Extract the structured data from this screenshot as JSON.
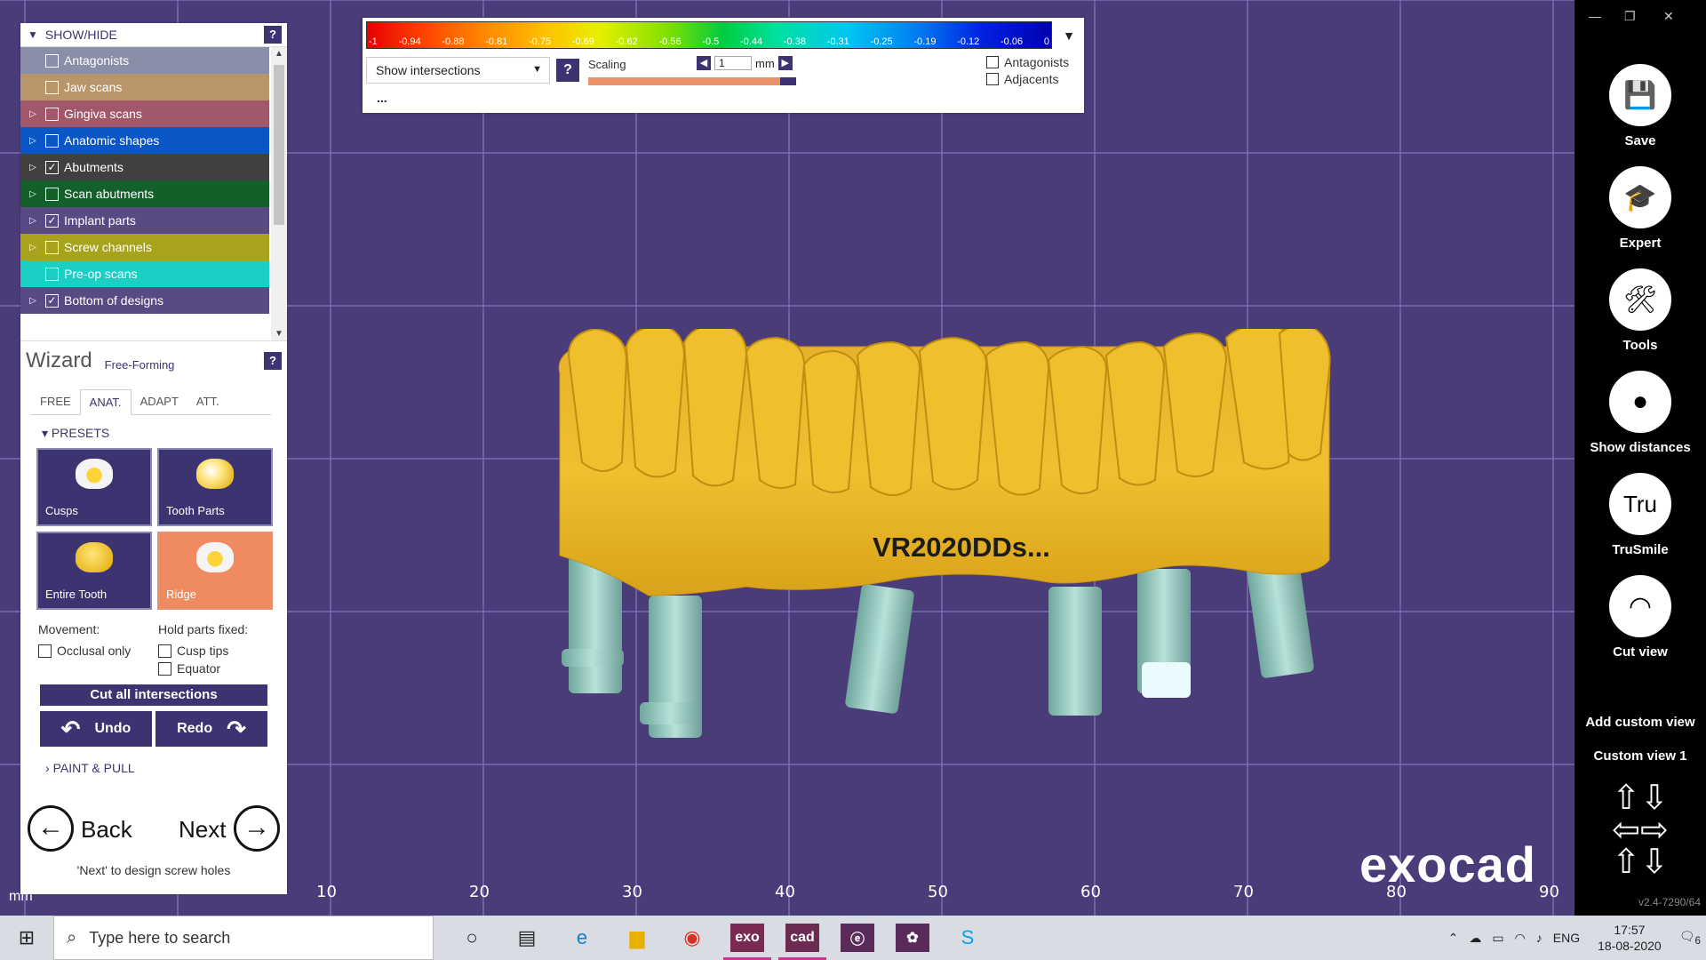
{
  "show_hide": {
    "title": "SHOW/HIDE",
    "help": "?",
    "items": [
      {
        "label": "Antagonists",
        "color": "#8b8ea8",
        "checked": false,
        "expandable": false
      },
      {
        "label": "Jaw scans",
        "color": "#b8956a",
        "checked": false,
        "expandable": false
      },
      {
        "label": "Gingiva scans",
        "color": "#a0586a",
        "checked": false,
        "expandable": true
      },
      {
        "label": "Anatomic shapes",
        "color": "#0a56c6",
        "checked": false,
        "expandable": true
      },
      {
        "label": "Abutments",
        "color": "#404040",
        "checked": true,
        "expandable": true
      },
      {
        "label": "Scan abutments",
        "color": "#14602a",
        "checked": false,
        "expandable": true
      },
      {
        "label": "Implant parts",
        "color": "#5a4a84",
        "checked": true,
        "expandable": true
      },
      {
        "label": "Screw channels",
        "color": "#a8a31c",
        "checked": false,
        "expandable": true
      },
      {
        "label": "Pre-op scans",
        "color": "#1ccfc4",
        "checked": false,
        "expandable": false
      },
      {
        "label": "Bottom of designs",
        "color": "#5a4a84",
        "checked": true,
        "expandable": true
      }
    ]
  },
  "wizard": {
    "title": "Wizard",
    "subtitle": "Free-Forming",
    "help": "?",
    "tabs": [
      "FREE",
      "ANAT.",
      "ADAPT",
      "ATT."
    ],
    "active_tab": "ANAT.",
    "presets_label": "PRESETS",
    "presets": [
      "Cusps",
      "Tooth Parts",
      "Entire Tooth",
      "Ridge"
    ],
    "active_preset": "Ridge",
    "movement_label": "Movement:",
    "hold_label": "Hold parts fixed:",
    "occlusal_only": "Occlusal only",
    "cusp_tips": "Cusp tips",
    "equator": "Equator",
    "cut_all": "Cut all intersections",
    "undo": "Undo",
    "redo": "Redo",
    "paint_pull": "PAINT & PULL",
    "back": "Back",
    "next": "Next",
    "hint": "'Next' to design screw holes"
  },
  "toolbar": {
    "scale_ticks": [
      "-1",
      "-0.94",
      "-0.88",
      "-0.81",
      "-0.75",
      "-0.69",
      "-0.62",
      "-0.56",
      "-0.5",
      "-0.44",
      "-0.38",
      "-0.31",
      "-0.25",
      "-0.19",
      "-0.12",
      "-0.06",
      "0"
    ],
    "mode": "Show intersections",
    "help": "?",
    "scaling_label": "Scaling",
    "scaling_value": "1",
    "scaling_unit": "mm",
    "antagonists": "Antagonists",
    "adjacents": "Adjacents",
    "more": "..."
  },
  "viewport": {
    "x_ticks": [
      "10",
      "20",
      "30",
      "40",
      "50",
      "60",
      "70",
      "80",
      "90"
    ],
    "unit": "mm",
    "watermark": "VR2020DDs...",
    "logo": "exocad"
  },
  "right_bar": {
    "items": [
      "Save",
      "Expert",
      "Tools",
      "Show distances",
      "TruSmile",
      "Cut view"
    ],
    "add_custom_view": "Add custom view",
    "custom_view_1": "Custom view 1",
    "version": "v2.4-7290/64",
    "window_controls": [
      "—",
      "❐",
      "✕"
    ]
  },
  "taskbar": {
    "search_placeholder": "Type here to search",
    "apps": [
      "exo",
      "cad"
    ],
    "lang": "ENG",
    "time": "17:57",
    "date": "18-08-2020",
    "notifications": "6"
  }
}
